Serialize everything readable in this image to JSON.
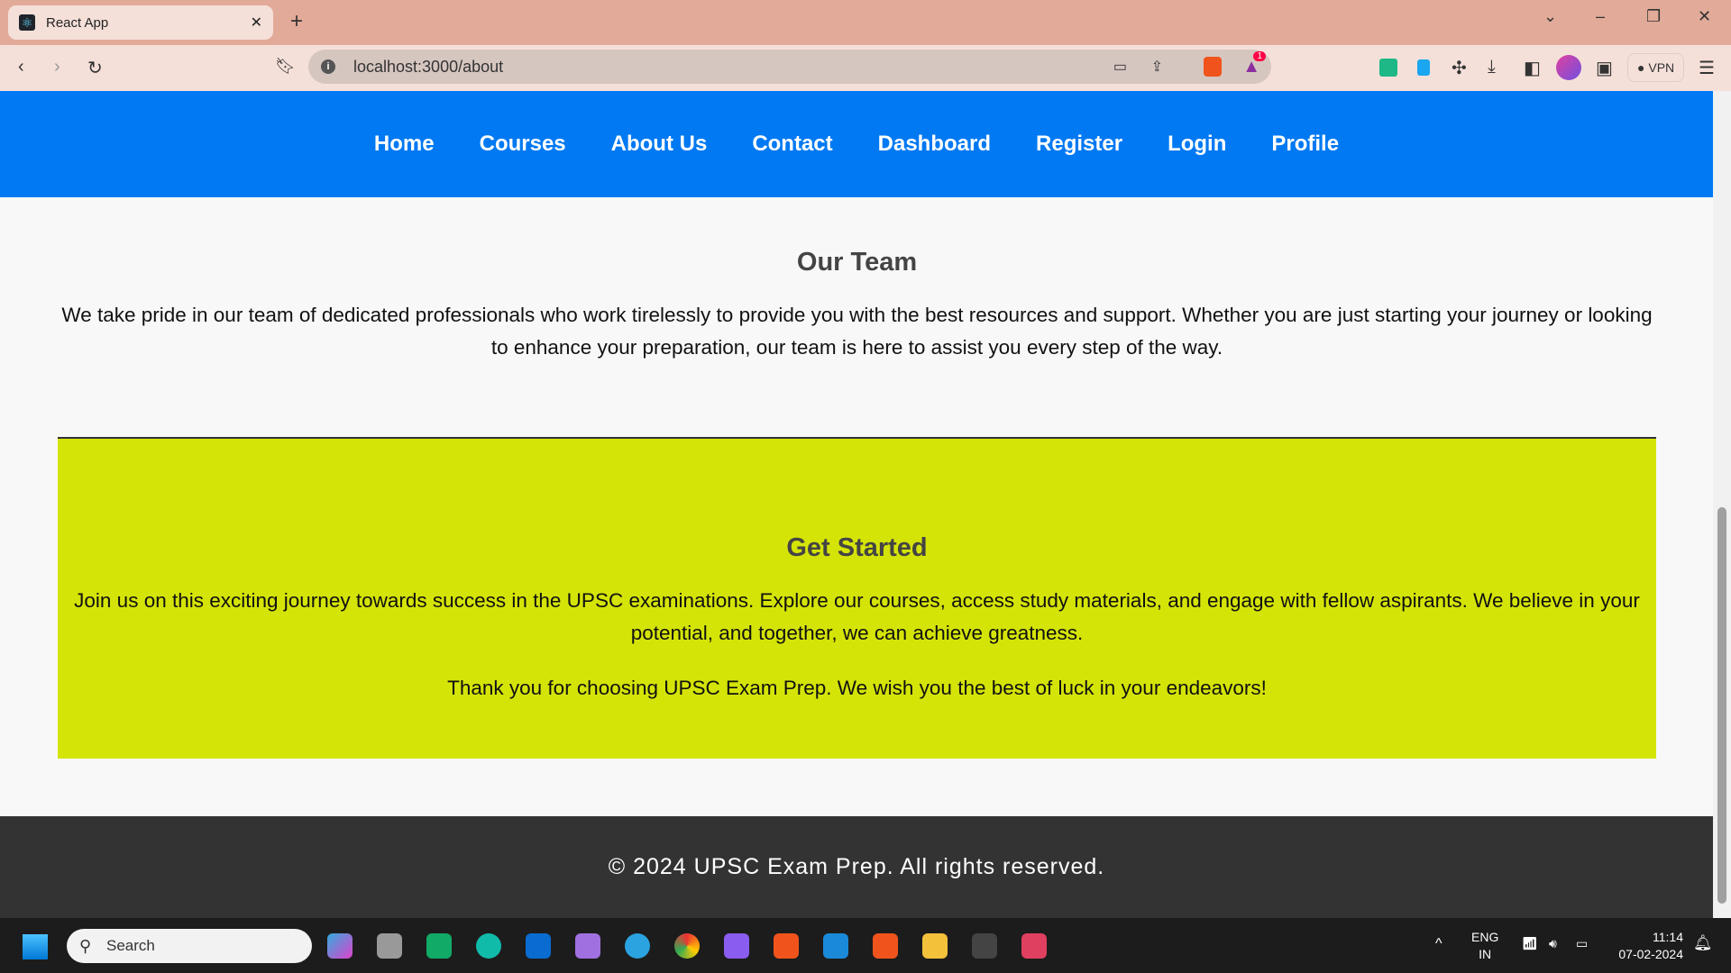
{
  "browser": {
    "tab_title": "React App",
    "url": "localhost:3000/about",
    "vpn_label": "VPN",
    "notification_count": "1"
  },
  "nav": {
    "items": [
      "Home",
      "Courses",
      "About Us",
      "Contact",
      "Dashboard",
      "Register",
      "Login",
      "Profile"
    ]
  },
  "team": {
    "heading": "Our Team",
    "text": "We take pride in our team of dedicated professionals who work tirelessly to provide you with the best resources and support. Whether you are just starting your journey or looking to enhance your preparation, our team is here to assist you every step of the way."
  },
  "get_started": {
    "heading": "Get Started",
    "text": "Join us on this exciting journey towards success in the UPSC examinations. Explore our courses, access study materials, and engage with fellow aspirants. We believe in your potential, and together, we can achieve greatness.",
    "thanks": "Thank you for choosing UPSC Exam Prep. We wish you the best of luck in your endeavors!",
    "bg_color": "#d5e407"
  },
  "footer": {
    "text": "© 2024 UPSC Exam Prep. All rights reserved."
  },
  "taskbar": {
    "search_placeholder": "Search",
    "lang": "ENG",
    "region": "IN",
    "time": "11:14",
    "date": "07-02-2024"
  },
  "colors": {
    "nav": "#0079f2",
    "footer": "#333333"
  }
}
